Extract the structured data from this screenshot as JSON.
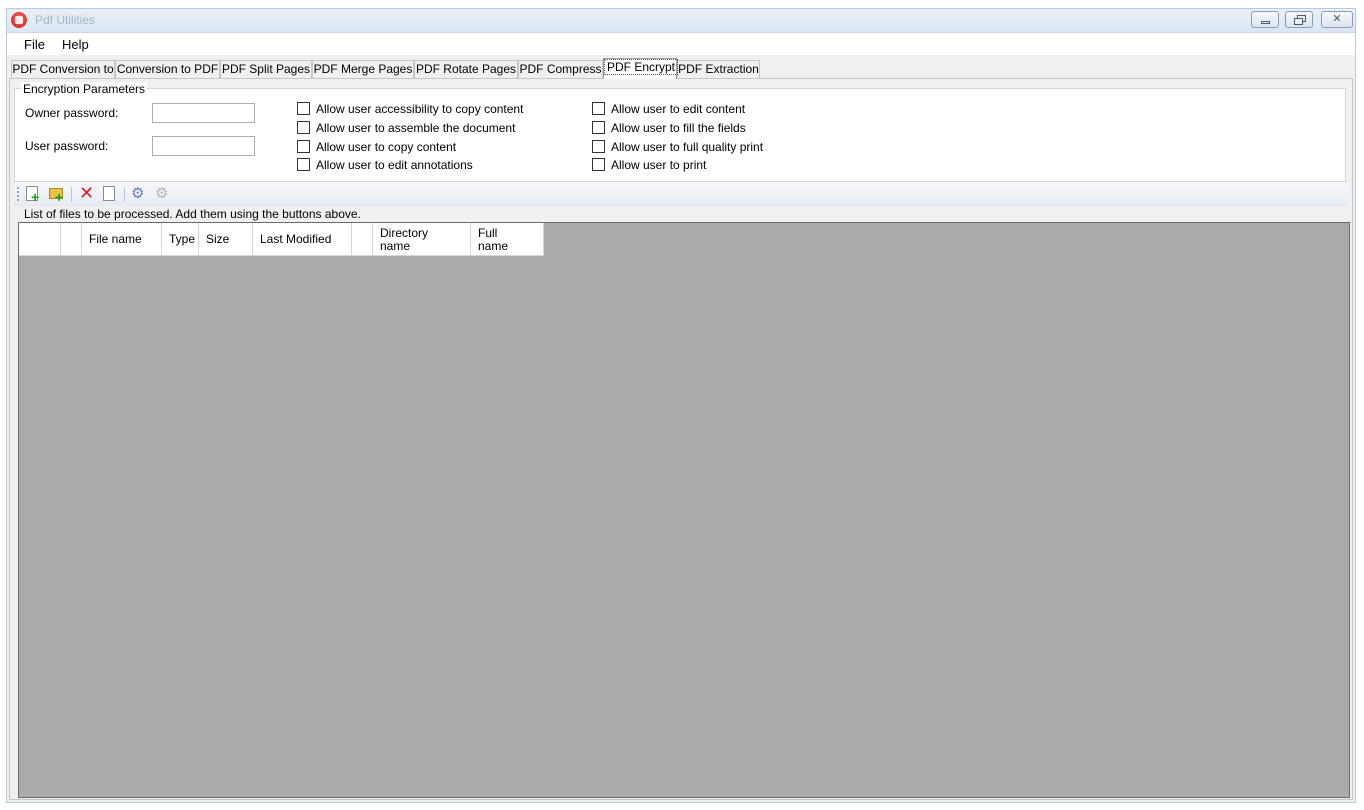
{
  "window": {
    "title": "Pdf Utilities",
    "controls": {
      "minimize": "minimize",
      "restore": "restore",
      "close": "close"
    }
  },
  "menu": {
    "items": [
      "File",
      "Help"
    ]
  },
  "tabs": [
    {
      "label": "PDF Conversion to",
      "active": false
    },
    {
      "label": "Conversion to PDF",
      "active": false
    },
    {
      "label": "PDF Split Pages",
      "active": false
    },
    {
      "label": "PDF Merge Pages",
      "active": false
    },
    {
      "label": "PDF Rotate Pages",
      "active": false
    },
    {
      "label": "PDF Compress",
      "active": false
    },
    {
      "label": "PDF Encrypt",
      "active": true
    },
    {
      "label": "PDF Extraction",
      "active": false
    }
  ],
  "encryption": {
    "group_title": "Encryption Parameters",
    "owner_label": "Owner password:",
    "owner_value": "",
    "user_label": "User password:",
    "user_value": "",
    "permissions_left": [
      {
        "label": "Allow user accessibility to copy content",
        "checked": false
      },
      {
        "label": "Allow user to assemble the document",
        "checked": false
      },
      {
        "label": "Allow user to copy content",
        "checked": false
      },
      {
        "label": "Allow user to edit annotations",
        "checked": false
      }
    ],
    "permissions_right": [
      {
        "label": "Allow user to edit content",
        "checked": false
      },
      {
        "label": "Allow user to fill the fields",
        "checked": false
      },
      {
        "label": "Allow user to full quality print",
        "checked": false
      },
      {
        "label": "Allow user to print",
        "checked": false
      }
    ]
  },
  "toolbar": {
    "buttons": [
      "add-file-icon",
      "add-folder-icon",
      "delete-icon",
      "new-document-icon",
      "process-icon",
      "process-disabled-icon"
    ]
  },
  "files": {
    "caption": "List of files to be processed. Add  them using the buttons above.",
    "columns": [
      "",
      "",
      "File name",
      "Type",
      "Size",
      "Last Modified",
      "",
      "Directory name",
      "Full name"
    ],
    "rows": []
  },
  "colors": {
    "grid_background": "#ababab",
    "titlebar": "#dce6f2",
    "window_background": "#f0f0f0"
  }
}
